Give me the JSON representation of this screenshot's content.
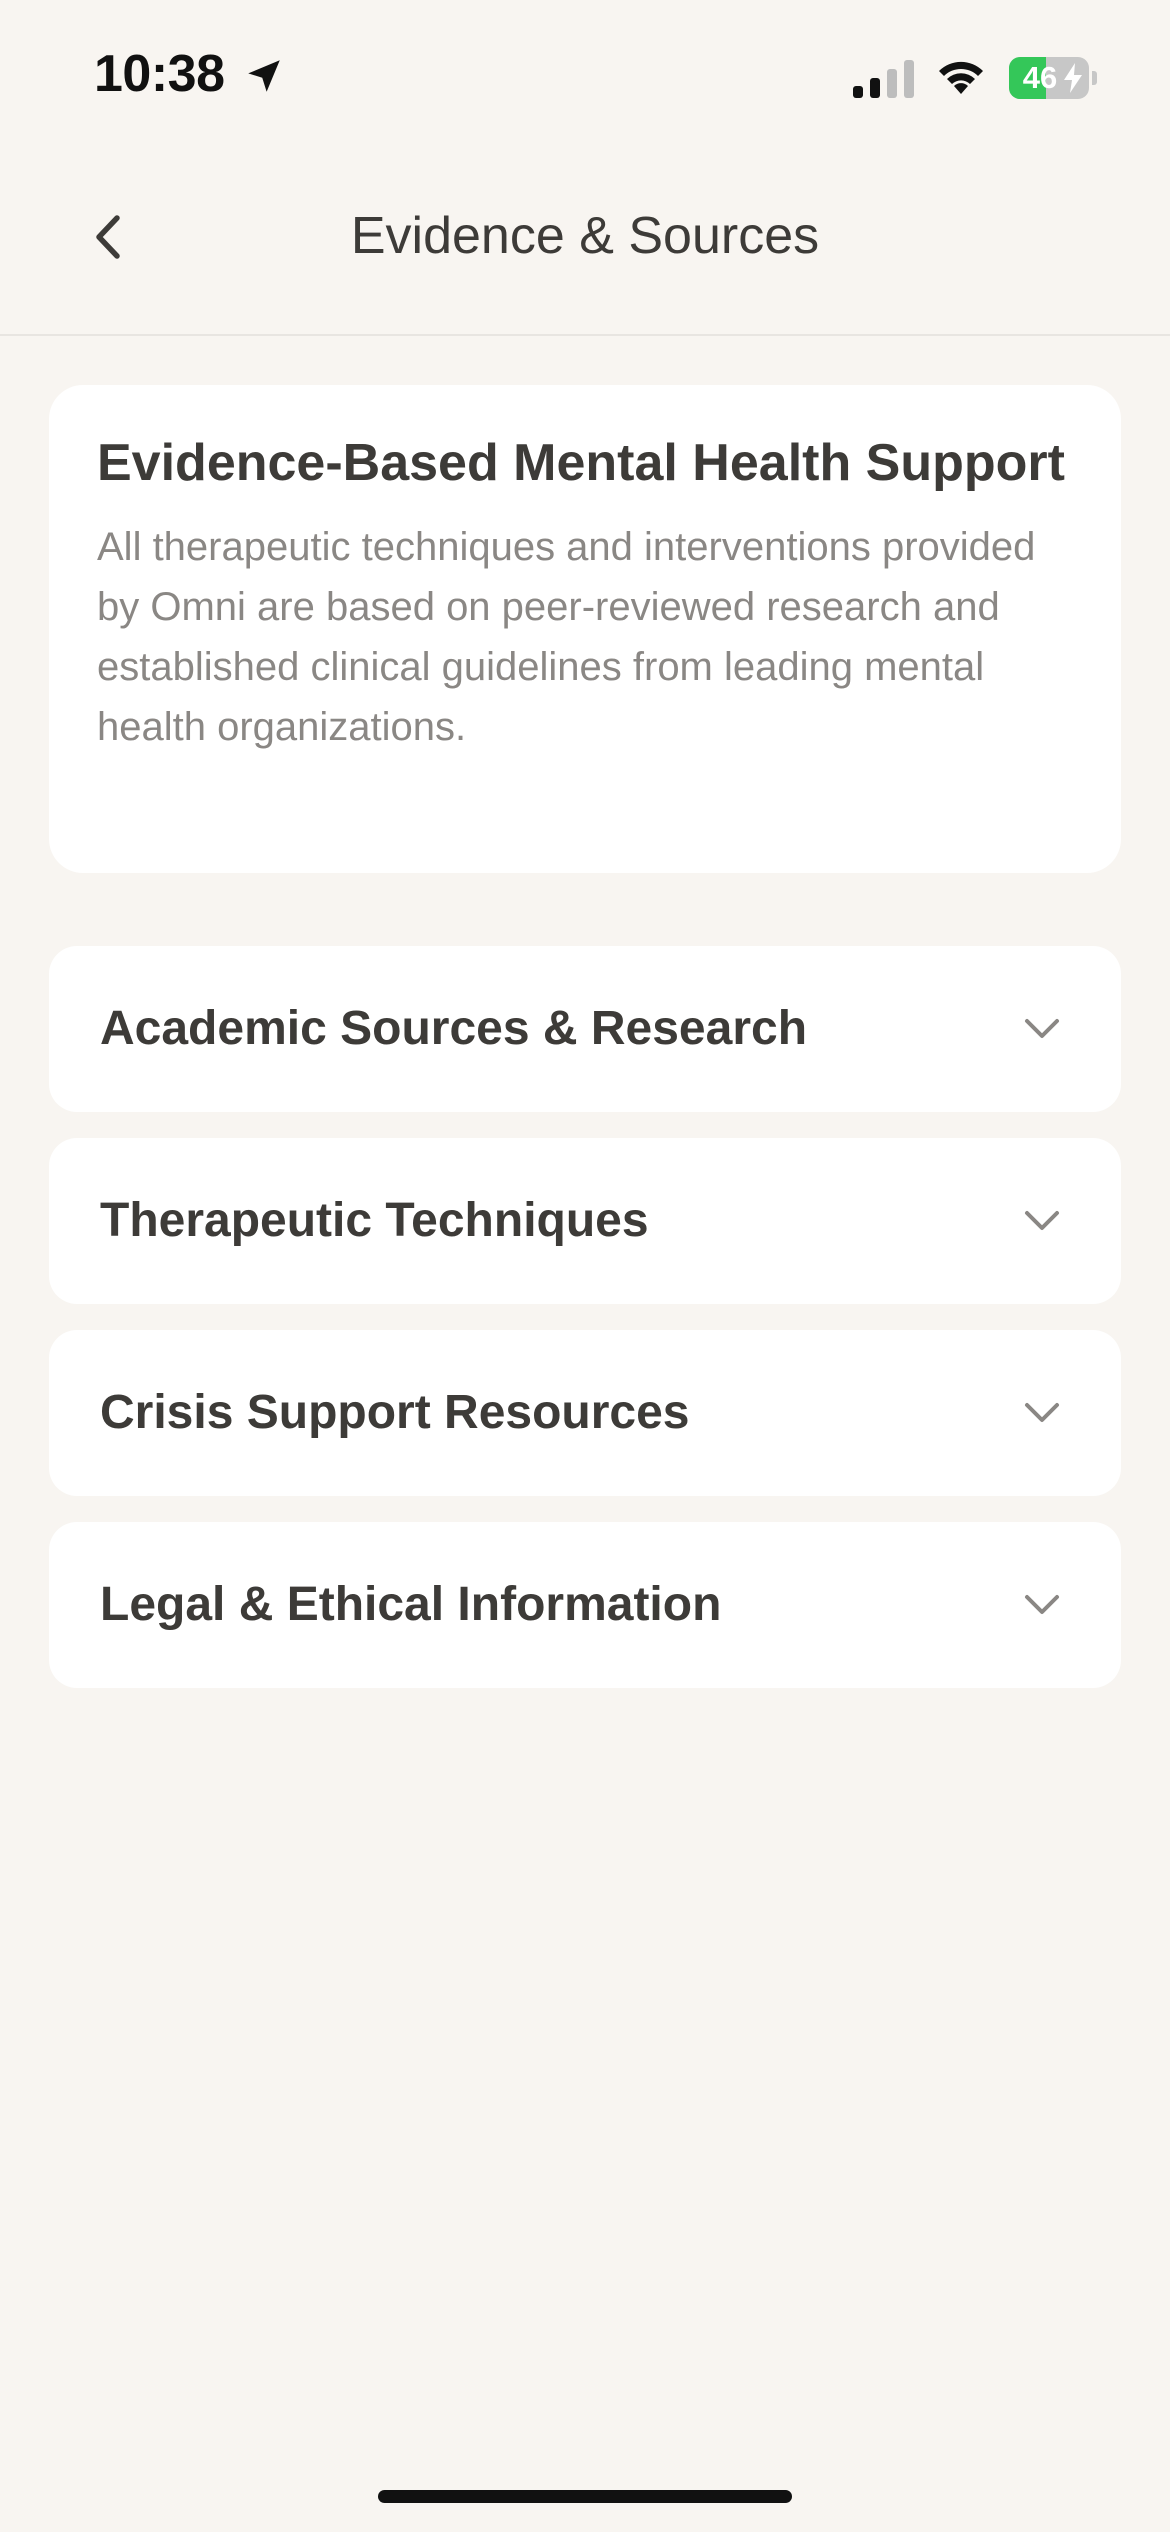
{
  "status_bar": {
    "time": "10:38",
    "battery_level": "46",
    "battery_fraction": 0.46,
    "signal_bars_active": 2,
    "signal_bars_total": 4,
    "icons": [
      "location-arrow-icon",
      "cellular-signal-icon",
      "wifi-icon",
      "battery-charging-icon"
    ]
  },
  "header": {
    "title": "Evidence & Sources",
    "back_icon": "chevron-left-icon"
  },
  "intro": {
    "title": "Evidence-Based Mental Health Support",
    "body": "All therapeutic techniques and interventions provided by Omni are based on peer-reviewed research and established clinical guidelines from leading mental health organizations."
  },
  "sections": [
    {
      "label": "Academic Sources & Research",
      "expanded": false
    },
    {
      "label": "Therapeutic Techniques",
      "expanded": false
    },
    {
      "label": "Crisis Support Resources",
      "expanded": false
    },
    {
      "label": "Legal & Ethical Information",
      "expanded": false
    }
  ],
  "colors": {
    "background": "#f8f5f1",
    "card": "#ffffff",
    "text_primary": "#3d3b38",
    "text_secondary": "#8a8784",
    "battery_green": "#34c759"
  }
}
